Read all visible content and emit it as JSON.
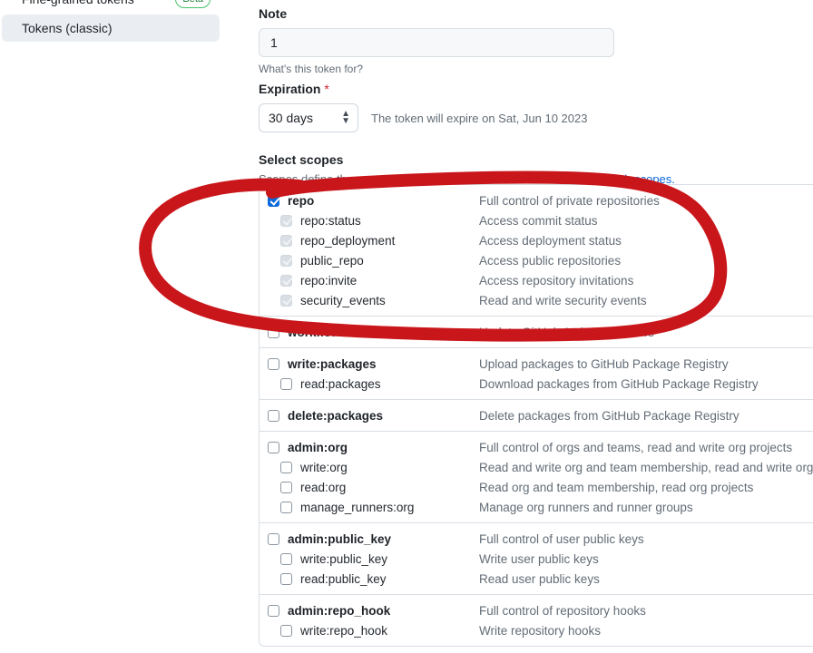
{
  "sidebar": {
    "items": [
      {
        "label": "Fine-grained tokens",
        "badge": "Beta",
        "active": false
      },
      {
        "label": "Tokens (classic)",
        "badge": "",
        "active": true
      }
    ]
  },
  "form": {
    "note_label": "Note",
    "note_value": "1",
    "note_placeholder": "What's this token for?",
    "note_help": "What's this token for?",
    "expiration_label": "Expiration",
    "required_marker": "*",
    "expiration_value": "30 days",
    "expiration_note": "The token will expire on Sat, Jun 10 2023",
    "scopes_title": "Select scopes",
    "scopes_sub": "Scopes define the access for personal tokens.",
    "scopes_link": "Read more about OAuth scopes."
  },
  "scopes": [
    {
      "rows": [
        {
          "name": "repo",
          "desc": "Full control of private repositories",
          "level": "parent",
          "state": "checked"
        },
        {
          "name": "repo:status",
          "desc": "Access commit status",
          "level": "child",
          "state": "dim"
        },
        {
          "name": "repo_deployment",
          "desc": "Access deployment status",
          "level": "child",
          "state": "dim"
        },
        {
          "name": "public_repo",
          "desc": "Access public repositories",
          "level": "child",
          "state": "dim"
        },
        {
          "name": "repo:invite",
          "desc": "Access repository invitations",
          "level": "child",
          "state": "dim"
        },
        {
          "name": "security_events",
          "desc": "Read and write security events",
          "level": "child",
          "state": "dim"
        }
      ]
    },
    {
      "rows": [
        {
          "name": "workflow",
          "desc": "Update GitHub Action workflows",
          "level": "parent",
          "state": "unchecked"
        }
      ]
    },
    {
      "rows": [
        {
          "name": "write:packages",
          "desc": "Upload packages to GitHub Package Registry",
          "level": "parent",
          "state": "unchecked"
        },
        {
          "name": "read:packages",
          "desc": "Download packages from GitHub Package Registry",
          "level": "child",
          "state": "unchecked"
        }
      ]
    },
    {
      "rows": [
        {
          "name": "delete:packages",
          "desc": "Delete packages from GitHub Package Registry",
          "level": "parent",
          "state": "unchecked"
        }
      ]
    },
    {
      "rows": [
        {
          "name": "admin:org",
          "desc": "Full control of orgs and teams, read and write org projects",
          "level": "parent",
          "state": "unchecked"
        },
        {
          "name": "write:org",
          "desc": "Read and write org and team membership, read and write org projects",
          "level": "child",
          "state": "unchecked"
        },
        {
          "name": "read:org",
          "desc": "Read org and team membership, read org projects",
          "level": "child",
          "state": "unchecked"
        },
        {
          "name": "manage_runners:org",
          "desc": "Manage org runners and runner groups",
          "level": "child",
          "state": "unchecked"
        }
      ]
    },
    {
      "rows": [
        {
          "name": "admin:public_key",
          "desc": "Full control of user public keys",
          "level": "parent",
          "state": "unchecked"
        },
        {
          "name": "write:public_key",
          "desc": "Write user public keys",
          "level": "child",
          "state": "unchecked"
        },
        {
          "name": "read:public_key",
          "desc": "Read user public keys",
          "level": "child",
          "state": "unchecked"
        }
      ]
    },
    {
      "rows": [
        {
          "name": "admin:repo_hook",
          "desc": "Full control of repository hooks",
          "level": "parent",
          "state": "unchecked"
        },
        {
          "name": "write:repo_hook",
          "desc": "Write repository hooks",
          "level": "child",
          "state": "unchecked"
        }
      ]
    }
  ],
  "annotation": {
    "type": "hand-drawn-ellipse",
    "color": "#c9161b",
    "stroke_width": 14,
    "encircles": "repo scope group"
  }
}
